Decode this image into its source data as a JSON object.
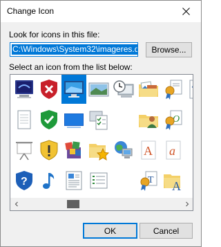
{
  "window": {
    "title": "Change Icon"
  },
  "file": {
    "label": "Look for icons in this file:",
    "path": "C:\\Windows\\System32\\imageres.dll",
    "browse_label": "Browse..."
  },
  "list": {
    "label": "Select an icon from the list below:"
  },
  "buttons": {
    "ok_label": "OK",
    "cancel_label": "Cancel"
  },
  "colors": {
    "accent": "#0078d7",
    "dialog_bg": "#f0f0f0"
  },
  "icons": [
    "monitor-screensaver-icon",
    "shield-red-x-icon",
    "monitor-icon",
    "landscape-picture-icon",
    "clock-monitor-icon",
    "pictures-folder-icon",
    "certificate-ribbon-icon",
    "font-file-icon",
    "document-icon",
    "shield-green-check-icon",
    "blue-screen-icon",
    "checklist-clipboard-icon",
    "blank-icon",
    "user-folder-icon",
    "certificate-green-icon",
    "blank-icon-2",
    "projector-screen-icon",
    "shield-warning-icon",
    "programs-box-icon",
    "star-folder-icon",
    "network-globe-icon",
    "font-a-icon",
    "font-a-italic-icon",
    "blank-icon-3",
    "shield-question-icon",
    "music-note-icon",
    "text-document-icon",
    "list-document-icon",
    "blank-icon-4",
    "certificate-font-icon",
    "font-folder-icon",
    "blank-icon-5"
  ]
}
